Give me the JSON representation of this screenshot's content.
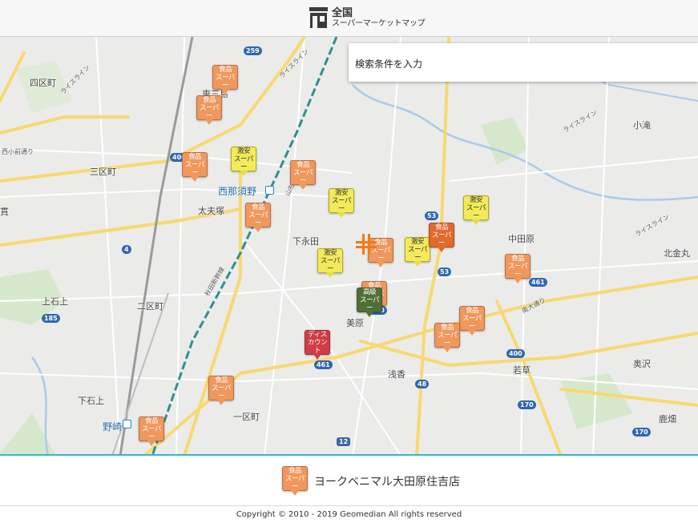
{
  "header": {
    "title": "全国",
    "subtitle": "スーパーマーケットマップ"
  },
  "search": {
    "placeholder": "検索条件を入力"
  },
  "map": {
    "places": [
      {
        "text": "四区町",
        "cls": ""
      },
      {
        "text": "三区町",
        "cls": ""
      },
      {
        "text": "西那須野",
        "cls": "blue"
      },
      {
        "text": "太夫塚",
        "cls": ""
      },
      {
        "text": "下永田",
        "cls": ""
      },
      {
        "text": "上石上",
        "cls": ""
      },
      {
        "text": "二区町",
        "cls": ""
      },
      {
        "text": "美原",
        "cls": ""
      },
      {
        "text": "浅香",
        "cls": ""
      },
      {
        "text": "下石上",
        "cls": ""
      },
      {
        "text": "野崎",
        "cls": "blue"
      },
      {
        "text": "一区町",
        "cls": ""
      },
      {
        "text": "中田原",
        "cls": ""
      },
      {
        "text": "北金丸",
        "cls": ""
      },
      {
        "text": "小滝",
        "cls": ""
      },
      {
        "text": "奥沢",
        "cls": ""
      },
      {
        "text": "若草",
        "cls": ""
      },
      {
        "text": "鹿畑",
        "cls": ""
      },
      {
        "text": "南大通り",
        "cls": "rd"
      },
      {
        "text": "ライスライン",
        "cls": "rd"
      },
      {
        "text": "ライスライン",
        "cls": "rd"
      },
      {
        "text": "ライスライン",
        "cls": "rd"
      },
      {
        "text": "ライスライン",
        "cls": "rd"
      },
      {
        "text": "山形新幹線",
        "cls": "rd"
      },
      {
        "text": "秋田新幹線",
        "cls": "rd"
      },
      {
        "text": "西小前通り",
        "cls": "rd"
      },
      {
        "text": "東三島",
        "cls": ""
      },
      {
        "text": "貫",
        "cls": ""
      }
    ],
    "shields": [
      "259",
      "400",
      "4",
      "185",
      "461",
      "53",
      "53",
      "461",
      "400",
      "48",
      "170",
      "170",
      "400",
      "12"
    ],
    "pin_labels": {
      "food": [
        "食品",
        "スーパー"
      ],
      "cheap": [
        "激安",
        "スーパー"
      ],
      "luxury": [
        "高級",
        "スーパー"
      ],
      "discount": [
        "ディス",
        "カウント"
      ]
    }
  },
  "selected_store": {
    "name": "ヨークベニマル大田原住吉店",
    "category": "food"
  },
  "footer": {
    "copyright": "Copyright © 2010 - 2019 Geomedian All rights reserved"
  },
  "colors": {
    "food": "#f0975c",
    "food_selected": "#e06a2c",
    "cheap": "#f2ea5a",
    "luxury": "#4f6f36",
    "discount": "#cf3d45",
    "accent_line": "#2bbcc7",
    "crosshair": "#f07a1a"
  }
}
